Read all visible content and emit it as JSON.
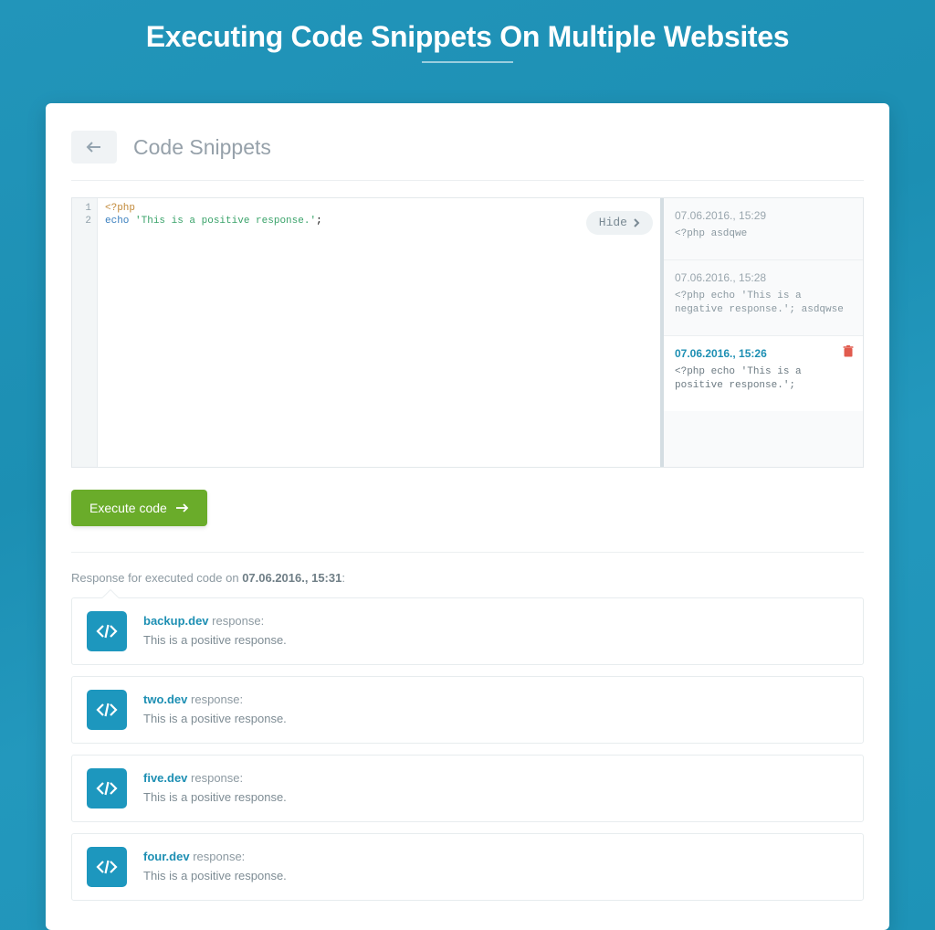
{
  "page": {
    "title": "Executing Code Snippets On Multiple Websites"
  },
  "panel": {
    "section_title": "Code Snippets",
    "hide_label": "Hide",
    "execute_label": "Execute code"
  },
  "editor": {
    "line_numbers": [
      "1",
      "2"
    ],
    "line1_raw": "<?php",
    "line2_indent": "    ",
    "line2_fn": "echo",
    "line2_space": " ",
    "line2_str": "'This is a positive response.'",
    "line2_tail": ";"
  },
  "history": [
    {
      "timestamp": "07.06.2016., 15:29",
      "snippet": "<?php asdqwe",
      "active": false
    },
    {
      "timestamp": "07.06.2016., 15:28",
      "snippet": "<?php echo 'This is a negative response.'; asdqwse",
      "active": false
    },
    {
      "timestamp": "07.06.2016., 15:26",
      "snippet": "<?php echo 'This is a positive response.';",
      "active": true
    }
  ],
  "response": {
    "prefix": "Response for executed code on ",
    "timestamp": "07.06.2016., 15:31",
    "suffix": ":",
    "label_suffix": " response:",
    "items": [
      {
        "site": "backup.dev",
        "text": "This is a positive response."
      },
      {
        "site": "two.dev",
        "text": "This is a positive response."
      },
      {
        "site": "five.dev",
        "text": "This is a positive response."
      },
      {
        "site": "four.dev",
        "text": "This is a positive response."
      }
    ]
  }
}
